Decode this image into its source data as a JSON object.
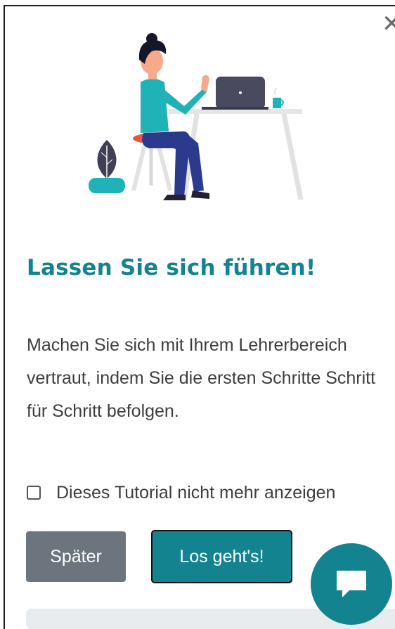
{
  "dialog": {
    "close_glyph": "✕",
    "title": "Lassen Sie sich führen!",
    "description": "Machen Sie sich mit Ihrem Lehrerbereich vertraut, indem Sie die ersten Schritte Schritt für Schritt befolgen.",
    "checkbox_label": "Dieses Tutorial nicht mehr anzeigen",
    "checkbox_checked": false,
    "later_button": "Später",
    "go_button": "Los geht's!",
    "progress": 0
  },
  "chat": {
    "icon": "chat-bubble-icon"
  },
  "colors": {
    "accent": "#13838f",
    "secondary_button": "#6c757d",
    "title": "#12838f",
    "text": "#3d3d3d",
    "progress_track": "#e9ecef"
  }
}
